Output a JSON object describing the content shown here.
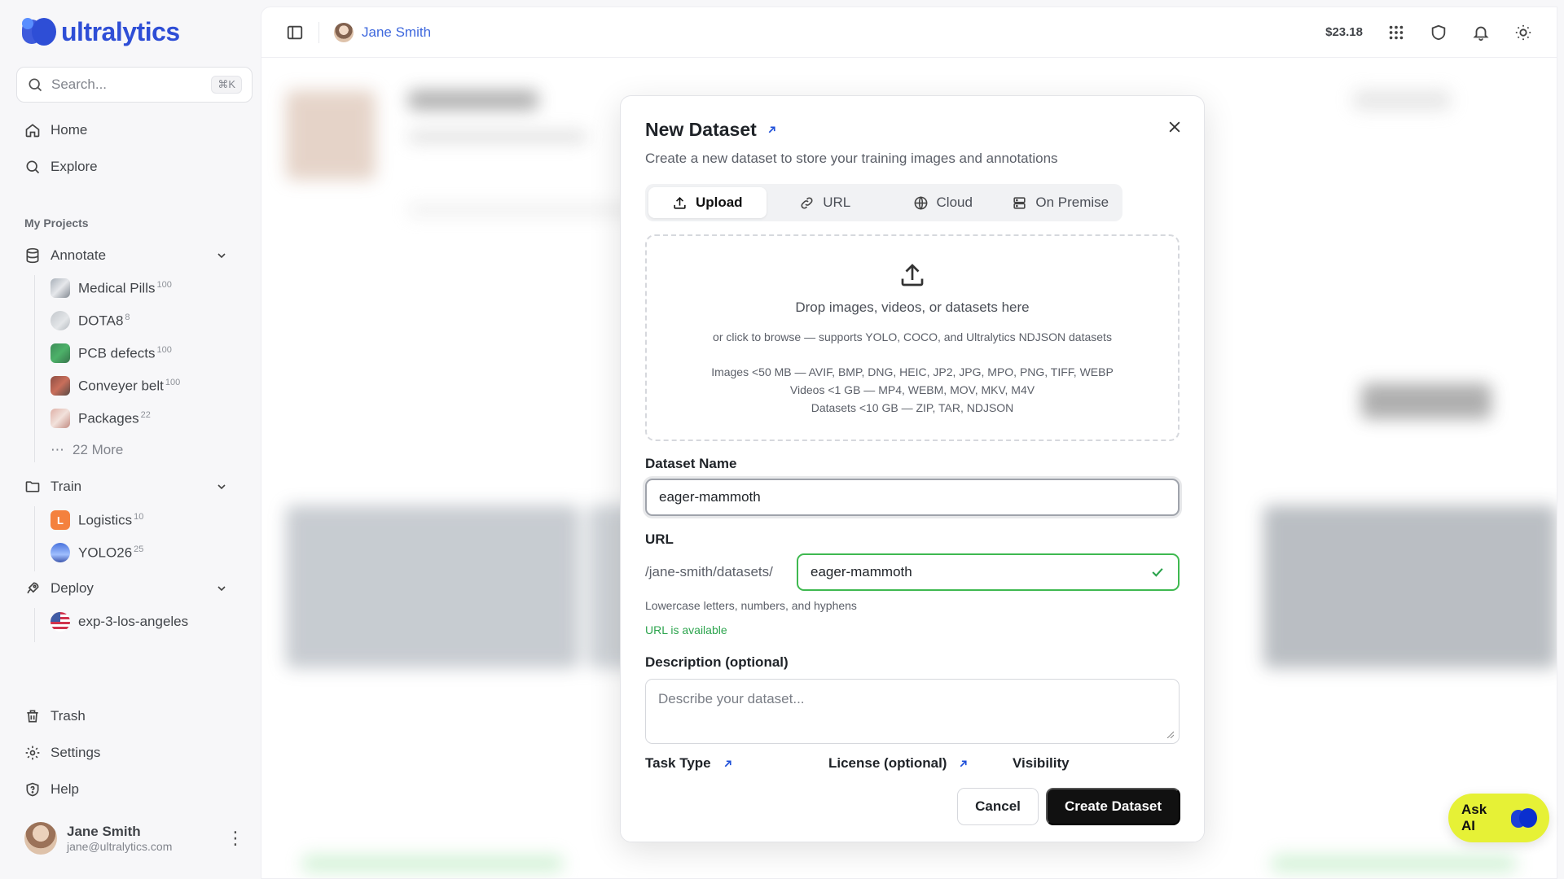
{
  "brand": {
    "name": "ultralytics",
    "color": "#0a2fcf"
  },
  "search": {
    "placeholder": "Search...",
    "shortcut": "⌘K"
  },
  "nav": {
    "home": "Home",
    "explore": "Explore"
  },
  "projects": {
    "label": "My Projects",
    "annotate": {
      "label": "Annotate",
      "items": [
        {
          "name": "Medical Pills",
          "count": "100"
        },
        {
          "name": "DOTA8",
          "count": "8"
        },
        {
          "name": "PCB defects",
          "count": "100"
        },
        {
          "name": "Conveyer belt",
          "count": "100"
        },
        {
          "name": "Packages",
          "count": "22"
        }
      ],
      "more": "22 More"
    },
    "train": {
      "label": "Train",
      "items": [
        {
          "name": "Logistics",
          "count": "10",
          "initial": "L"
        },
        {
          "name": "YOLO26",
          "count": "25"
        }
      ]
    },
    "deploy": {
      "label": "Deploy",
      "items": [
        {
          "name": "exp-3-los-angeles"
        }
      ]
    }
  },
  "bottom_nav": {
    "trash": "Trash",
    "settings": "Settings",
    "help": "Help"
  },
  "user": {
    "name": "Jane Smith",
    "email": "jane@ultralytics.com"
  },
  "topbar": {
    "breadcrumb": "Jane Smith",
    "balance": "$23.18"
  },
  "modal": {
    "title": "New Dataset",
    "subtitle": "Create a new dataset to store your training images and annotations",
    "tabs": [
      "Upload",
      "URL",
      "Cloud",
      "On Premise"
    ],
    "active_tab": "Upload",
    "dropzone": {
      "main": "Drop images, videos, or datasets here",
      "sub": "or click to browse — supports YOLO, COCO, and Ultralytics NDJSON datasets",
      "formats": [
        "Images <50 MB — AVIF, BMP, DNG, HEIC, JP2, JPG, MPO, PNG, TIFF, WEBP",
        "Videos <1 GB — MP4, WEBM, MOV, MKV, M4V",
        "Datasets <10 GB — ZIP, TAR, NDJSON"
      ]
    },
    "name_label": "Dataset Name",
    "name_value": "eager-mammoth",
    "url_label": "URL",
    "url_prefix": "/jane-smith/datasets/",
    "url_value": "eager-mammoth",
    "url_hint": "Lowercase letters, numbers, and hyphens",
    "url_status": "URL is available",
    "desc_label": "Description (optional)",
    "desc_placeholder": "Describe your dataset...",
    "task_label": "Task Type",
    "license_label": "License (optional)",
    "visibility_label": "Visibility",
    "cancel": "Cancel",
    "create": "Create Dataset"
  },
  "ask_ai": "Ask AI",
  "colors": {
    "success": "#3fb950",
    "accent_blue": "#1d4ed8",
    "ai_button": "#e6f136"
  }
}
